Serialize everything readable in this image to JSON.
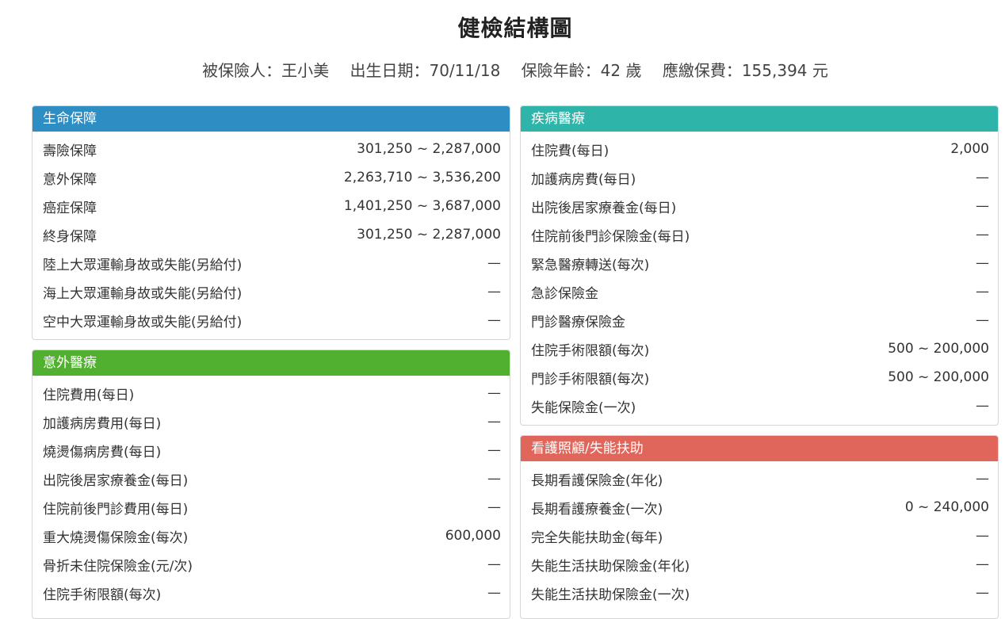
{
  "title": "健檢結構圖",
  "info": {
    "insured": "被保險人：王小美",
    "birth": "出生日期：70/11/18",
    "age": "保險年齡：42 歲",
    "premium": "應繳保費：155,394 元"
  },
  "colors": {
    "life": "#2e8ec3",
    "accident": "#52b030",
    "disease": "#2fb4a9",
    "care": "#e0655a"
  },
  "panels": {
    "life": {
      "title": "生命保障",
      "rows": [
        {
          "label": "壽險保障",
          "value": "301,250 ~ 2,287,000"
        },
        {
          "label": "意外保障",
          "value": "2,263,710 ~ 3,536,200"
        },
        {
          "label": "癌症保障",
          "value": "1,401,250 ~ 3,687,000"
        },
        {
          "label": "終身保障",
          "value": "301,250 ~ 2,287,000"
        },
        {
          "label": "陸上大眾運輸身故或失能(另給付)",
          "value": "—"
        },
        {
          "label": "海上大眾運輸身故或失能(另給付)",
          "value": "—"
        },
        {
          "label": "空中大眾運輸身故或失能(另給付)",
          "value": "—"
        }
      ]
    },
    "accident": {
      "title": "意外醫療",
      "rows": [
        {
          "label": "住院費用(每日)",
          "value": "—"
        },
        {
          "label": "加護病房費用(每日)",
          "value": "—"
        },
        {
          "label": "燒燙傷病房費(每日)",
          "value": "—"
        },
        {
          "label": "出院後居家療養金(每日)",
          "value": "—"
        },
        {
          "label": "住院前後門診費用(每日)",
          "value": "—"
        },
        {
          "label": "重大燒燙傷保險金(每次)",
          "value": "600,000"
        },
        {
          "label": "骨折未住院保險金(元/次)",
          "value": "—"
        },
        {
          "label": "住院手術限額(每次)",
          "value": "—"
        }
      ]
    },
    "disease": {
      "title": "疾病醫療",
      "rows": [
        {
          "label": "住院費(每日)",
          "value": "2,000"
        },
        {
          "label": "加護病房費(每日)",
          "value": "—"
        },
        {
          "label": "出院後居家療養金(每日)",
          "value": "—"
        },
        {
          "label": "住院前後門診保險金(每日)",
          "value": "—"
        },
        {
          "label": "緊急醫療轉送(每次)",
          "value": "—"
        },
        {
          "label": "急診保險金",
          "value": "—"
        },
        {
          "label": "門診醫療保險金",
          "value": "—"
        },
        {
          "label": "住院手術限額(每次)",
          "value": "500 ~ 200,000"
        },
        {
          "label": "門診手術限額(每次)",
          "value": "500 ~ 200,000"
        },
        {
          "label": "失能保險金(一次)",
          "value": "—"
        }
      ]
    },
    "care": {
      "title": "看護照顧/失能扶助",
      "rows": [
        {
          "label": "長期看護保險金(年化)",
          "value": "—"
        },
        {
          "label": "長期看護療養金(一次)",
          "value": "0 ~ 240,000"
        },
        {
          "label": "完全失能扶助金(每年)",
          "value": "—"
        },
        {
          "label": "失能生活扶助保險金(年化)",
          "value": "—"
        },
        {
          "label": "失能生活扶助保險金(一次)",
          "value": "—"
        }
      ]
    }
  }
}
